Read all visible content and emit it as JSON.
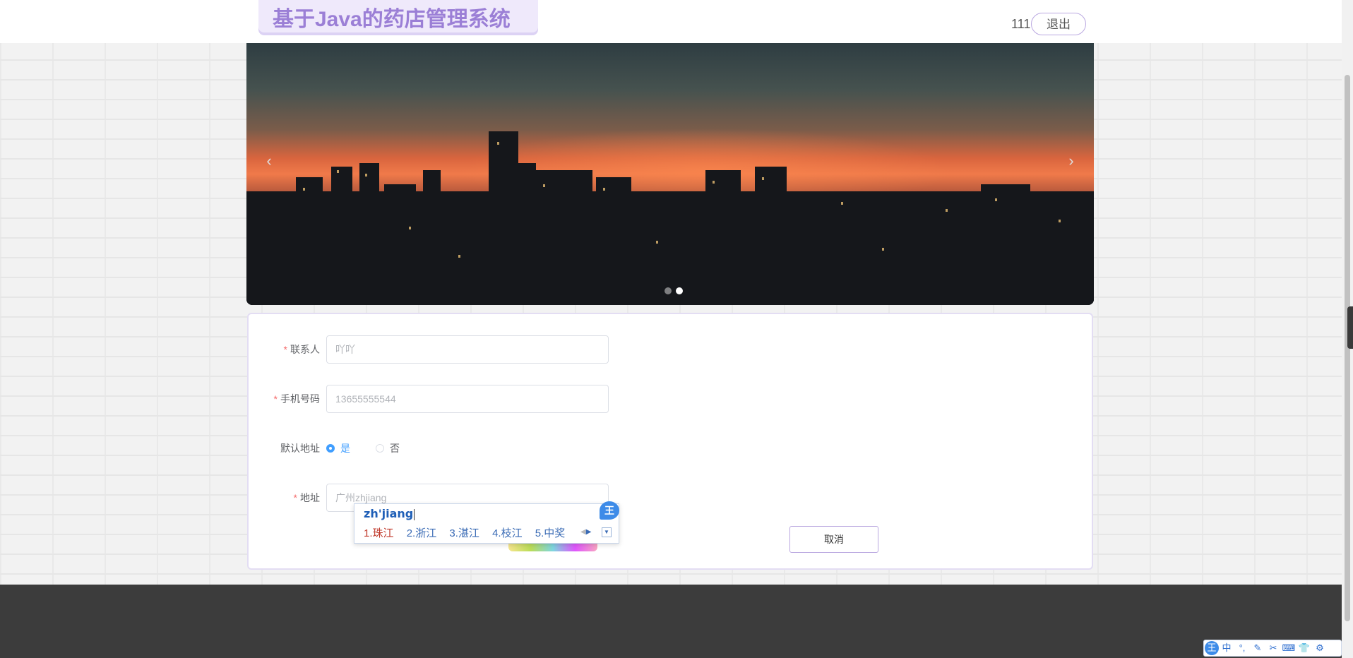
{
  "header": {
    "title": "基于Java的药店管理系统",
    "username": "111",
    "logout_label": "退出"
  },
  "carousel": {
    "prev_icon": "‹",
    "next_icon": "›",
    "slide_count": 2,
    "active_slide": 2
  },
  "form": {
    "contact": {
      "label": "联系人",
      "value": "吖吖",
      "required": true
    },
    "phone": {
      "label": "手机号码",
      "value": "13655555544",
      "required": true
    },
    "default_address": {
      "label": "默认地址",
      "options": [
        {
          "label": "是",
          "checked": true
        },
        {
          "label": "否",
          "checked": false
        }
      ]
    },
    "address": {
      "label": "地址",
      "value": "广州zhjiang",
      "required": true
    },
    "required_mark": "*",
    "cancel_label": "取消"
  },
  "ime_popup": {
    "pinyin": "zh'jiang",
    "logo": "王",
    "candidates": [
      "1.珠江",
      "2.浙江",
      "3.湛江",
      "4.枝江",
      "5.中奖"
    ],
    "nav_prev": "◀",
    "nav_next": "▶",
    "more_icon": "▼"
  },
  "ime_bar": {
    "items": [
      "王",
      "中",
      "°,",
      "✎",
      "✂",
      "⌨",
      "👕",
      "⚙"
    ]
  },
  "colors": {
    "brand_purple": "#9b7fd6",
    "radio_blue": "#409eff",
    "required_red": "#f56c6c",
    "footer": "#3c3c3c"
  }
}
